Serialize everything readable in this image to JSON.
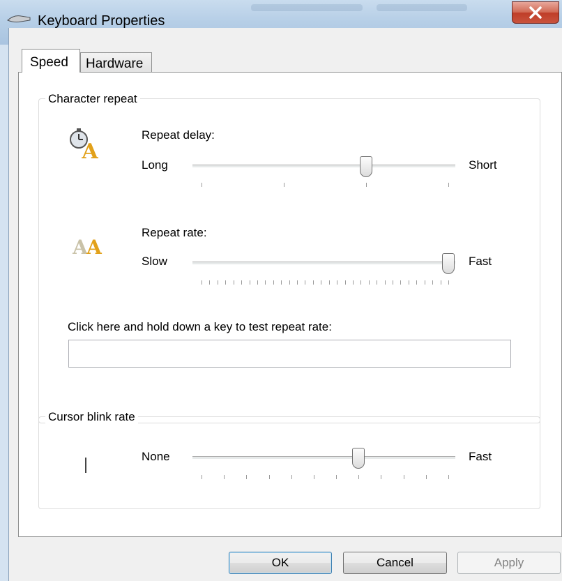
{
  "window": {
    "title": "Keyboard Properties",
    "close_label": "X"
  },
  "tabs": [
    {
      "label": "Speed",
      "selected": true
    },
    {
      "label": "Hardware",
      "selected": false
    }
  ],
  "character_repeat": {
    "group_label": "Character repeat",
    "repeat_delay": {
      "label": "Repeat delay:",
      "min_label": "Long",
      "max_label": "Short",
      "ticks": 4,
      "value_index": 2
    },
    "repeat_rate": {
      "label": "Repeat rate:",
      "min_label": "Slow",
      "max_label": "Fast",
      "ticks": 32,
      "value_index": 31
    },
    "test_label": "Click here and hold down a key to test repeat rate:",
    "test_value": ""
  },
  "cursor_blink": {
    "group_label": "Cursor blink rate",
    "min_label": "None",
    "max_label": "Fast",
    "ticks": 12,
    "value_index": 7
  },
  "buttons": {
    "ok": "OK",
    "cancel": "Cancel",
    "apply": "Apply"
  },
  "icons": {
    "window": "keyboard-icon",
    "delay": "stopwatch-letter-icon",
    "rate": "double-letter-icon",
    "cursor": "text-cursor-icon"
  }
}
